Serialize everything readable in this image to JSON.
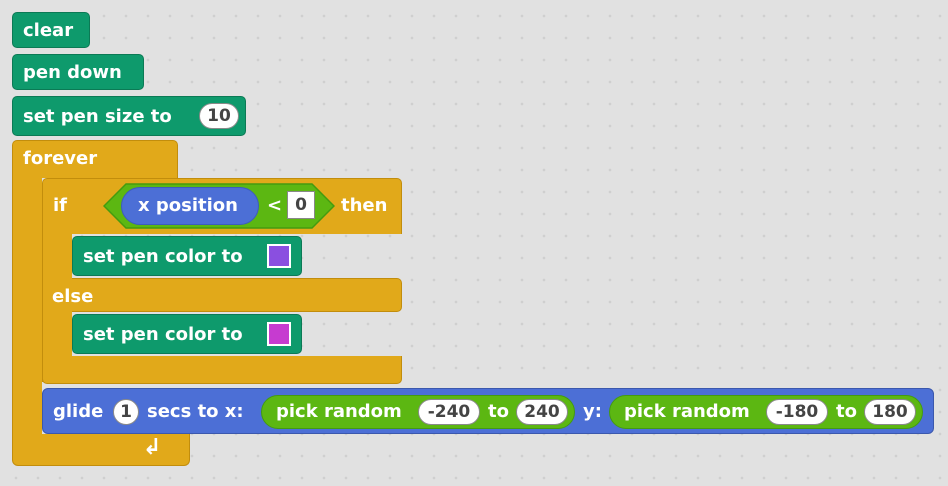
{
  "blocks": {
    "clear": "clear",
    "pen_down": "pen down",
    "set_pen_size": {
      "label": "set pen size to",
      "value": "10"
    },
    "forever": "forever",
    "if_else": {
      "if": "if",
      "x_position": "x position",
      "operator": "<",
      "compare_value": "0",
      "then": "then",
      "set_pen_color_1": {
        "label": "set pen color to",
        "color": "#8a4fe0"
      },
      "else": "else",
      "set_pen_color_2": {
        "label": "set pen color to",
        "color": "#c63bd0"
      }
    },
    "glide": {
      "label": "glide",
      "secs_value": "1",
      "secs_label": "secs to x:",
      "pick_random_x": {
        "label": "pick random",
        "from": "-240",
        "to_label": "to",
        "to": "240"
      },
      "y_label": "y:",
      "pick_random_y": {
        "label": "pick random",
        "from": "-180",
        "to_label": "to",
        "to": "180"
      }
    }
  },
  "colors": {
    "pen": "#0e9a6c",
    "control": "#e1a91a",
    "motion": "#4c6fd6",
    "operators": "#5cb712"
  }
}
